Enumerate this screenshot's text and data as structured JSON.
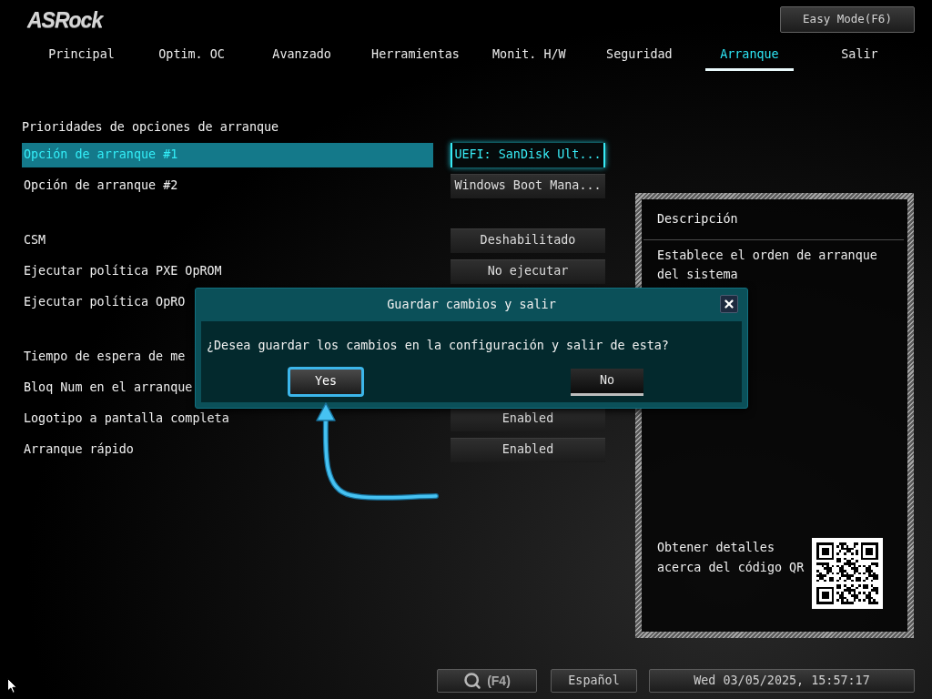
{
  "logo": "ASRock",
  "easy_mode_button": "Easy Mode(F6)",
  "tabs": [
    {
      "label": "Principal",
      "selected": false
    },
    {
      "label": "Optim. OC",
      "selected": false
    },
    {
      "label": "Avanzado",
      "selected": false
    },
    {
      "label": "Herramientas",
      "selected": false
    },
    {
      "label": "Monit. H/W",
      "selected": false
    },
    {
      "label": "Seguridad",
      "selected": false
    },
    {
      "label": "Arranque",
      "selected": true
    },
    {
      "label": "Salir",
      "selected": false
    }
  ],
  "settings": {
    "heading": "Prioridades de opciones de arranque",
    "groups": [
      {
        "items": [
          {
            "label": "Opción de arranque #1",
            "value": "UEFI: SanDisk Ult...",
            "selected": true
          },
          {
            "label": "Opción de arranque #2",
            "value": "Windows Boot Mana...",
            "selected": false
          }
        ]
      },
      {
        "items": [
          {
            "label": "CSM",
            "value": "Deshabilitado",
            "selected": false
          },
          {
            "label": "Ejecutar política PXE OpROM",
            "value": "No ejecutar",
            "selected": false
          },
          {
            "label": "Ejecutar política OpRO",
            "selected": false
          }
        ]
      },
      {
        "items": [
          {
            "label": "Tiempo de espera de me",
            "selected": false
          },
          {
            "label": "Bloq Num en el arranque",
            "selected": false
          },
          {
            "label": "Logotipo a pantalla completa",
            "value": "Enabled",
            "selected": false
          },
          {
            "label": "Arranque rápido",
            "value": "Enabled",
            "selected": false
          }
        ]
      }
    ]
  },
  "description_panel": {
    "title": "Descripción",
    "text": "Establece el orden de arranque del sistema",
    "qr_text": "Obtener detalles acerca del código QR"
  },
  "dialog": {
    "title": "Guardar cambios y salir",
    "message": "¿Desea guardar los cambios en la configuración y salir de esta?",
    "buttons": [
      {
        "label": "Yes",
        "selected": true
      },
      {
        "label": "No",
        "selected": false
      }
    ]
  },
  "bottom_bar": {
    "search_key": "(F4)",
    "language": "Español",
    "datetime": "Wed 03/05/2025, 15:57:17"
  }
}
